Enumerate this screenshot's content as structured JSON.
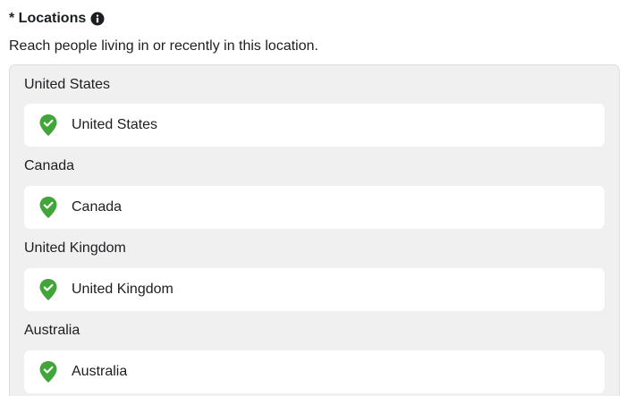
{
  "field": {
    "label": "* Locations",
    "info_icon": "info-circle-icon",
    "help_text": "Reach people living in or recently in this location."
  },
  "colors": {
    "pin_green": "#42a53a",
    "panel_background": "#f0f0f0",
    "chip_background": "#ffffff",
    "text": "#1c1e21"
  },
  "locations": [
    {
      "heading": "United States",
      "item": "United States",
      "icon": "location-pin-check-icon"
    },
    {
      "heading": "Canada",
      "item": "Canada",
      "icon": "location-pin-check-icon"
    },
    {
      "heading": "United Kingdom",
      "item": "United Kingdom",
      "icon": "location-pin-check-icon"
    },
    {
      "heading": "Australia",
      "item": "Australia",
      "icon": "location-pin-check-icon"
    }
  ]
}
